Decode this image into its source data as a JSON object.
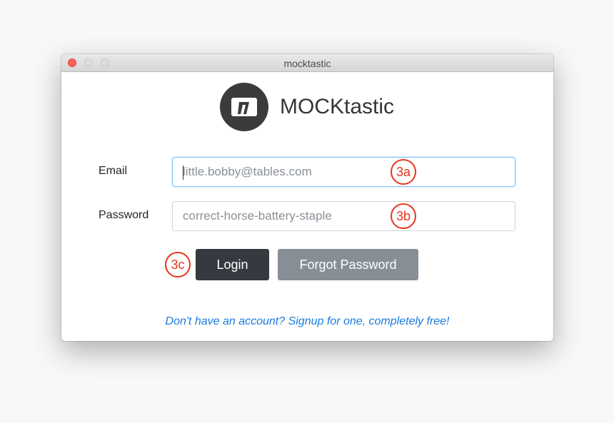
{
  "window": {
    "title": "mocktastic"
  },
  "brand": {
    "name": "MOCKtastic",
    "logo_icon": "m-logo-icon"
  },
  "form": {
    "email_label": "Email",
    "email_placeholder": "little.bobby@tables.com",
    "password_label": "Password",
    "password_placeholder": "correct-horse-battery-staple"
  },
  "annotations": {
    "email": "3a",
    "password": "3b",
    "login": "3c"
  },
  "buttons": {
    "login": "Login",
    "forgot": "Forgot Password"
  },
  "signup_text": "Don't have an account? Signup for one, completely free!",
  "colors": {
    "accent": "#1a7be0",
    "annotation": "#e8341c",
    "login_button": "#343a40",
    "forgot_button": "#868e96"
  }
}
